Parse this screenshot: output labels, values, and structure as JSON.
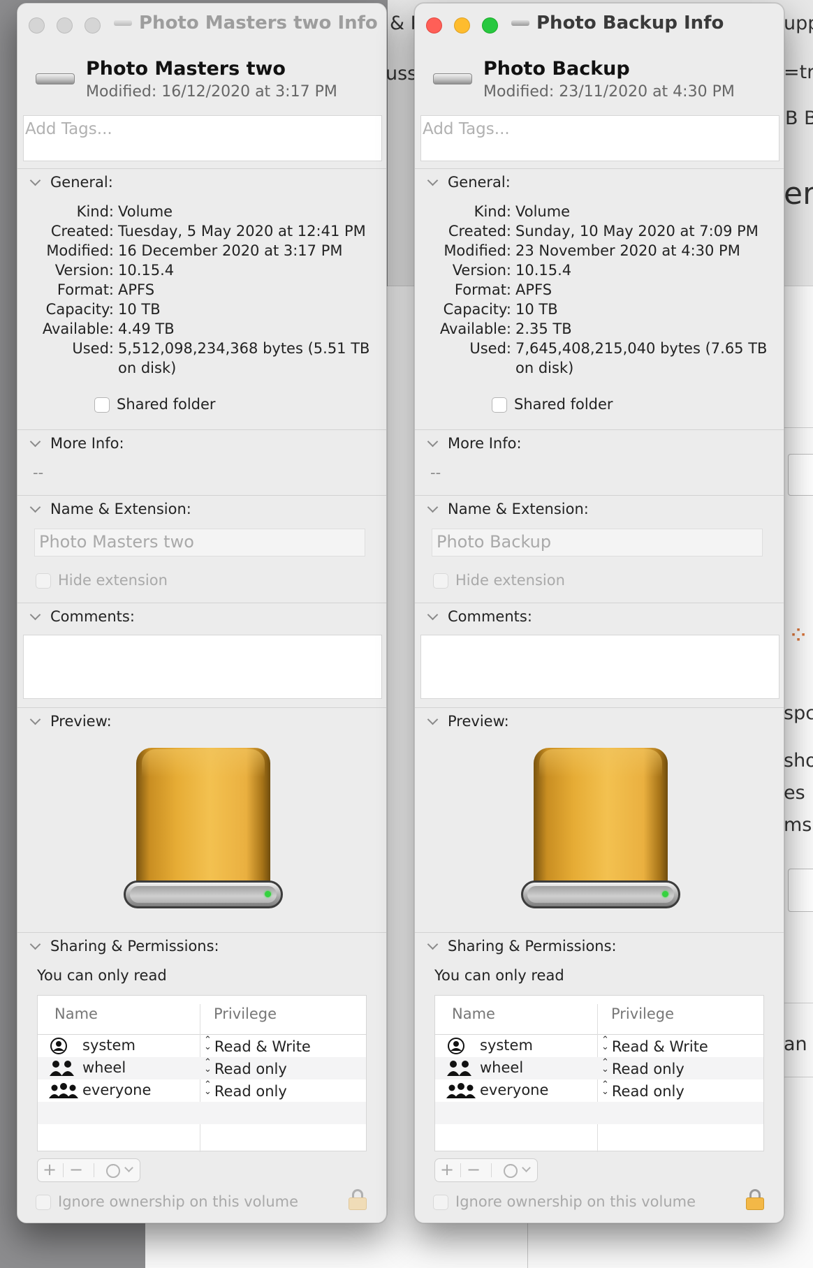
{
  "background": {
    "peek_texts": [
      "& P",
      "uss",
      "upp",
      "=tr",
      "B B",
      "er",
      "spc",
      "sho",
      "es",
      "ms",
      "an"
    ]
  },
  "windows": [
    {
      "id": "masters",
      "active": false,
      "title": "Photo Masters two  Info",
      "name": "Photo Masters two",
      "modified_header": "Modified:  16/12/2020 at 3:17 PM",
      "tags_placeholder": "Add Tags...",
      "general": {
        "label": "General:",
        "rows": [
          {
            "key": "Kind:",
            "value": "Volume"
          },
          {
            "key": "Created:",
            "value": "Tuesday, 5 May 2020 at 12:41 PM"
          },
          {
            "key": "Modified:",
            "value": "16 December 2020 at 3:17 PM"
          },
          {
            "key": "Version:",
            "value": "10.15.4"
          },
          {
            "key": "Format:",
            "value": "APFS"
          },
          {
            "key": "Capacity:",
            "value": "10 TB"
          },
          {
            "key": "Available:",
            "value": "4.49 TB"
          },
          {
            "key": "Used:",
            "value": "5,512,098,234,368 bytes (5.51 TB"
          }
        ],
        "used_cont": "on disk)",
        "shared_folder": "Shared folder"
      },
      "more_info": {
        "label": "More Info:",
        "value": "--"
      },
      "name_ext": {
        "label": "Name & Extension:",
        "value": "Photo Masters two",
        "hide_ext": "Hide extension"
      },
      "comments": {
        "label": "Comments:"
      },
      "preview": {
        "label": "Preview:"
      },
      "sharing": {
        "label": "Sharing & Permissions:",
        "note": "You can only read",
        "col_name": "Name",
        "col_priv": "Privilege",
        "rows": [
          {
            "user": "system",
            "icon": "single-user-icon",
            "priv": "Read & Write"
          },
          {
            "user": "wheel",
            "icon": "group-icon",
            "priv": "Read only"
          },
          {
            "user": "everyone",
            "icon": "everyone-icon",
            "priv": "Read only"
          }
        ],
        "ignore_ownership": "Ignore ownership on this volume"
      }
    },
    {
      "id": "backup",
      "active": true,
      "title": "Photo Backup Info",
      "name": "Photo Backup",
      "modified_header": "Modified:  23/11/2020 at 4:30 PM",
      "tags_placeholder": "Add Tags...",
      "general": {
        "label": "General:",
        "rows": [
          {
            "key": "Kind:",
            "value": "Volume"
          },
          {
            "key": "Created:",
            "value": "Sunday, 10 May 2020 at 7:09 PM"
          },
          {
            "key": "Modified:",
            "value": "23 November 2020 at 4:30 PM"
          },
          {
            "key": "Version:",
            "value": "10.15.4"
          },
          {
            "key": "Format:",
            "value": "APFS"
          },
          {
            "key": "Capacity:",
            "value": "10 TB"
          },
          {
            "key": "Available:",
            "value": "2.35 TB"
          },
          {
            "key": "Used:",
            "value": "7,645,408,215,040 bytes (7.65 TB"
          }
        ],
        "used_cont": "on disk)",
        "shared_folder": "Shared folder"
      },
      "more_info": {
        "label": "More Info:",
        "value": "--"
      },
      "name_ext": {
        "label": "Name & Extension:",
        "value": "Photo Backup",
        "hide_ext": "Hide extension"
      },
      "comments": {
        "label": "Comments:"
      },
      "preview": {
        "label": "Preview:"
      },
      "sharing": {
        "label": "Sharing & Permissions:",
        "note": "You can only read",
        "col_name": "Name",
        "col_priv": "Privilege",
        "rows": [
          {
            "user": "system",
            "icon": "single-user-icon",
            "priv": "Read & Write"
          },
          {
            "user": "wheel",
            "icon": "group-icon",
            "priv": "Read only"
          },
          {
            "user": "everyone",
            "icon": "everyone-icon",
            "priv": "Read only"
          }
        ],
        "ignore_ownership": "Ignore ownership on this volume"
      }
    }
  ]
}
